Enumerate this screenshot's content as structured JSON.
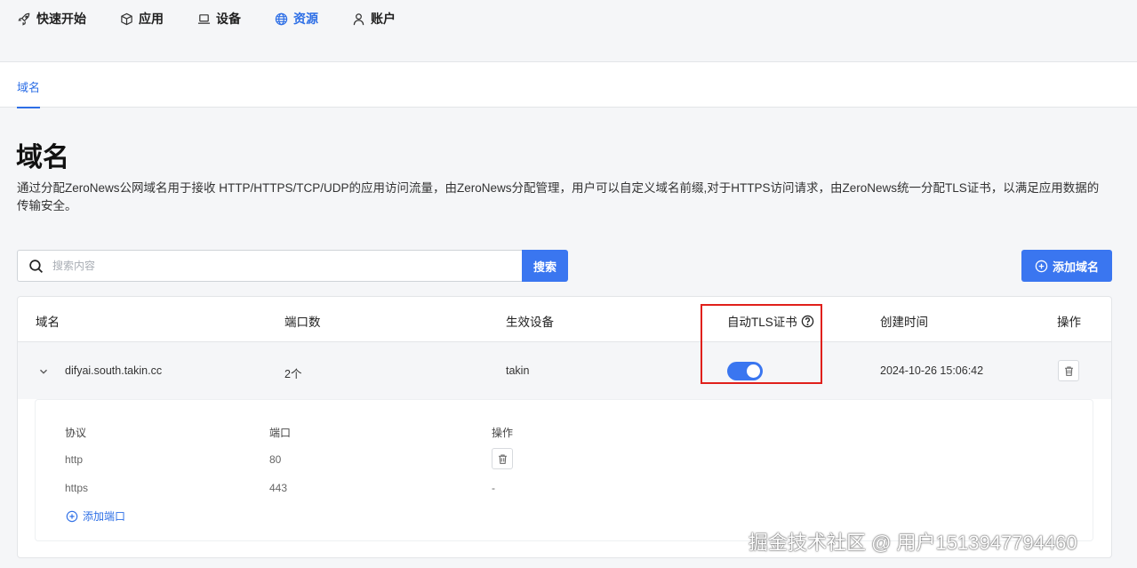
{
  "nav": {
    "items": [
      {
        "label": "快速开始",
        "icon": "rocket-icon"
      },
      {
        "label": "应用",
        "icon": "cube-icon"
      },
      {
        "label": "设备",
        "icon": "laptop-icon"
      },
      {
        "label": "资源",
        "icon": "globe-icon",
        "active": true
      },
      {
        "label": "账户",
        "icon": "user-icon"
      }
    ]
  },
  "subtabs": {
    "domain": "域名"
  },
  "page": {
    "title": "域名",
    "description": "通过分配ZeroNews公网域名用于接收 HTTP/HTTPS/TCP/UDP的应用访问流量，由ZeroNews分配管理，用户可以自定义域名前缀,对于HTTPS访问请求，由ZeroNews统一分配TLS证书，以满足应用数据的传输安全。"
  },
  "search": {
    "placeholder": "搜索内容",
    "button": "搜索"
  },
  "add_domain_button": "添加域名",
  "table": {
    "headers": {
      "domain": "域名",
      "ports": "端口数",
      "device": "生效设备",
      "tls": "自动TLS证书",
      "created": "创建时间",
      "action": "操作"
    },
    "rows": [
      {
        "domain": "difyai.south.takin.cc",
        "ports": "2个",
        "device": "takin",
        "tls_enabled": true,
        "created": "2024-10-26 15:06:42",
        "subtable": {
          "headers": {
            "protocol": "协议",
            "port": "端口",
            "action": "操作"
          },
          "rows": [
            {
              "protocol": "http",
              "port": "80",
              "action": ""
            },
            {
              "protocol": "https",
              "port": "443",
              "action": "-"
            }
          ],
          "add_port": "添加端口"
        }
      }
    ]
  },
  "watermark": "掘金技术社区 @ 用户1513947794460",
  "colors": {
    "accent": "#3a76f0",
    "highlight": "#e0201b"
  }
}
